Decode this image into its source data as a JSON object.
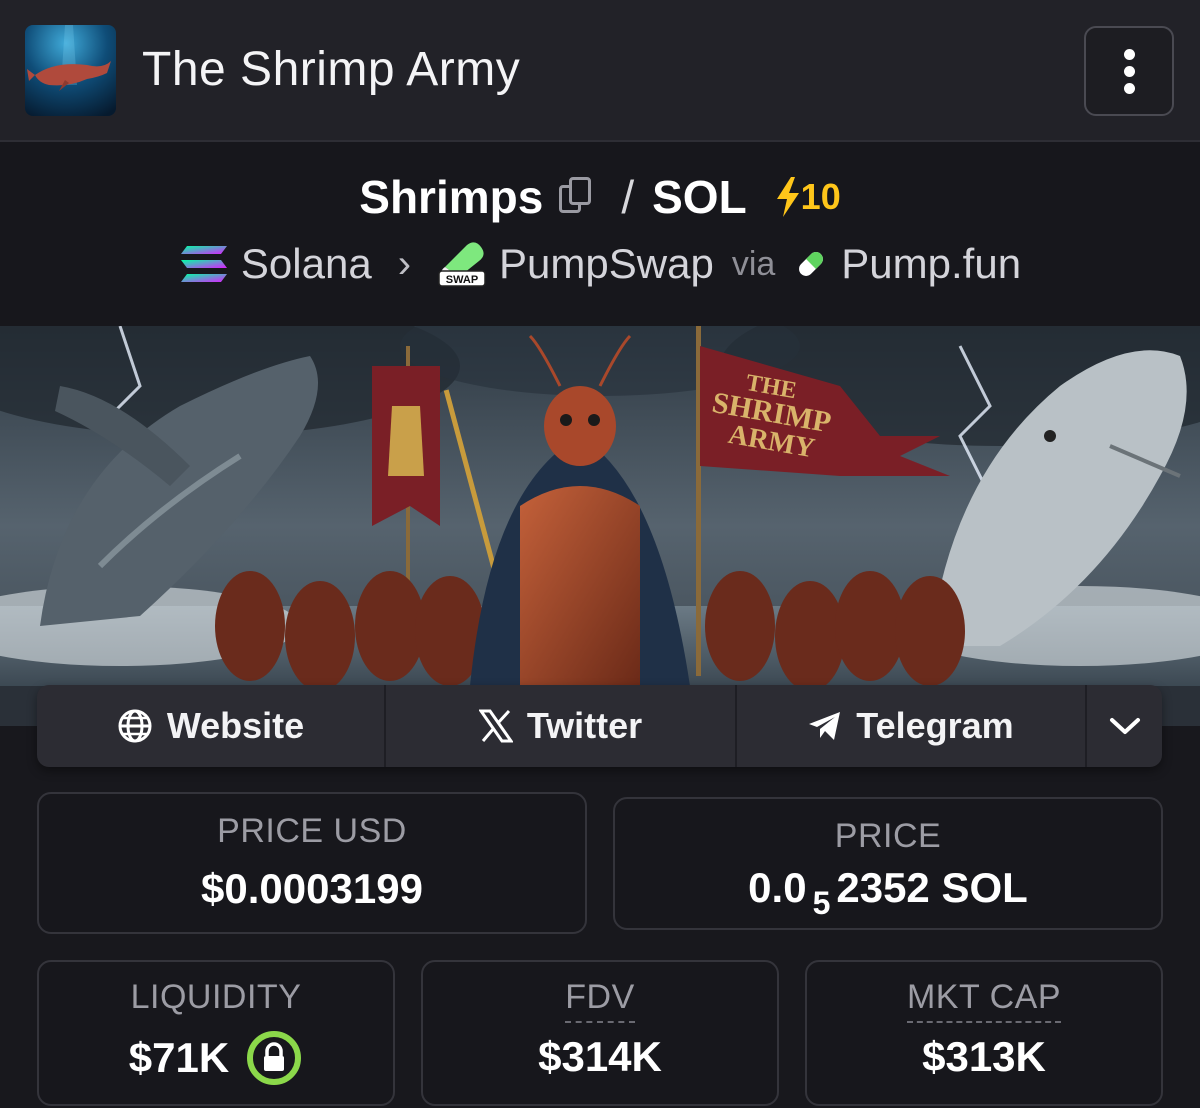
{
  "header": {
    "title": "The Shrimp Army",
    "menu_icon": "kebab-menu-icon"
  },
  "pair": {
    "base": "Shrimps",
    "separator": "/",
    "quote": "SOL",
    "boost_count": "10",
    "boost_color": "#ffc61a"
  },
  "chain": {
    "network": "Solana",
    "dex": "PumpSwap",
    "dex_badge": "SWAP",
    "via": "via",
    "launchpad": "Pump.fun"
  },
  "banner": {
    "flag_text": [
      "THE",
      "SHRIMP",
      "ARMY"
    ]
  },
  "socials": [
    {
      "label": "Website",
      "icon": "globe-icon"
    },
    {
      "label": "Twitter",
      "icon": "x-logo-icon"
    },
    {
      "label": "Telegram",
      "icon": "telegram-icon"
    }
  ],
  "stats": {
    "price_usd": {
      "label": "PRICE USD",
      "value": "$0.0003199"
    },
    "price": {
      "label": "PRICE",
      "value_prefix": "0.0",
      "value_sub": "5",
      "value_rest": "2352 SOL"
    },
    "liquidity": {
      "label": "LIQUIDITY",
      "value": "$71K",
      "lock_color": "#8bd84a"
    },
    "fdv": {
      "label": "FDV",
      "value": "$314K"
    },
    "mkt_cap": {
      "label": "MKT CAP",
      "value": "$313K"
    }
  }
}
